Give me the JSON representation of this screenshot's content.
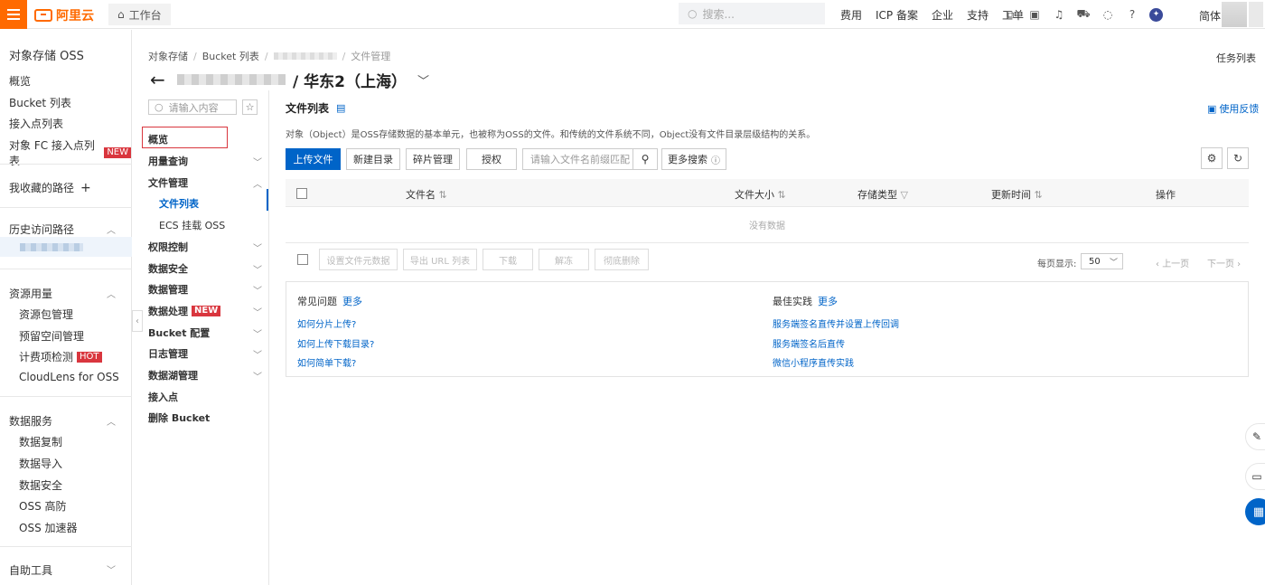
{
  "topbar": {
    "brand": "阿里云",
    "workbench": "工作台",
    "search_placeholder": "搜索...",
    "links": [
      "费用",
      "ICP 备案",
      "企业",
      "支持",
      "工单"
    ],
    "lang": "简体"
  },
  "sidebar": {
    "title": "对象存储 OSS",
    "items": [
      "概览",
      "Bucket 列表",
      "接入点列表",
      "对象 FC 接入点列表"
    ],
    "new_badge": "NEW",
    "favorites": "我收藏的路径",
    "history": "历史访问路径",
    "resources_title": "资源用量",
    "resources": [
      "资源包管理",
      "预留空间管理",
      "计费项检测",
      "CloudLens for OSS"
    ],
    "hot_badge": "HOT",
    "data_services_title": "数据服务",
    "data_services": [
      "数据复制",
      "数据导入",
      "数据安全",
      "OSS 高防",
      "OSS 加速器"
    ],
    "tools_title": "自助工具"
  },
  "breadcrumb": {
    "root": "对象存储",
    "bucket_list": "Bucket 列表",
    "current": "文件管理"
  },
  "task_list": "任务列表",
  "header": {
    "region": "/ 华东2（上海）"
  },
  "nav2": {
    "search_placeholder": "请输入内容",
    "overview": "概览",
    "usage": "用量查询",
    "file_mgmt": "文件管理",
    "file_list": "文件列表",
    "ecs_mount": "ECS 挂载 OSS",
    "permission": "权限控制",
    "data_security": "数据安全",
    "data_mgmt": "数据管理",
    "data_process": "数据处理",
    "new_badge": "NEW",
    "bucket_config": "Bucket 配置",
    "log_mgmt": "日志管理",
    "lake_mgmt": "数据湖管理",
    "access_point": "接入点",
    "delete_bucket": "删除 Bucket"
  },
  "main": {
    "title": "文件列表",
    "feedback": "使用反馈",
    "description": "对象（Object）是OSS存储数据的基本单元，也被称为OSS的文件。和传统的文件系统不同，Object没有文件目录层级结构的关系。",
    "upload": "上传文件",
    "new_dir": "新建目录",
    "fragments": "碎片管理",
    "authorize": "授权",
    "name_filter_placeholder": "请输入文件名前缀匹配",
    "more_search": "更多搜索",
    "columns": [
      "文件名",
      "文件大小",
      "存储类型",
      "更新时间",
      "操作"
    ],
    "empty": "没有数据",
    "bulk": [
      "设置文件元数据",
      "导出 URL 列表",
      "下载",
      "解冻",
      "彻底删除"
    ],
    "per_page_label": "每页显示:",
    "per_page": "50",
    "prev": "上一页",
    "next": "下一页"
  },
  "faq": {
    "title": "常见问题",
    "more": "更多",
    "links": [
      "如何分片上传?",
      "如何上传下载目录?",
      "如何简单下载?"
    ]
  },
  "best": {
    "title": "最佳实践",
    "more": "更多",
    "links": [
      "服务端签名直传并设置上传回调",
      "服务端签名后直传",
      "微信小程序直传实践"
    ]
  },
  "colors": {
    "accent": "#0064c8",
    "brand": "#ff6a00",
    "badge": "#d9363e"
  }
}
